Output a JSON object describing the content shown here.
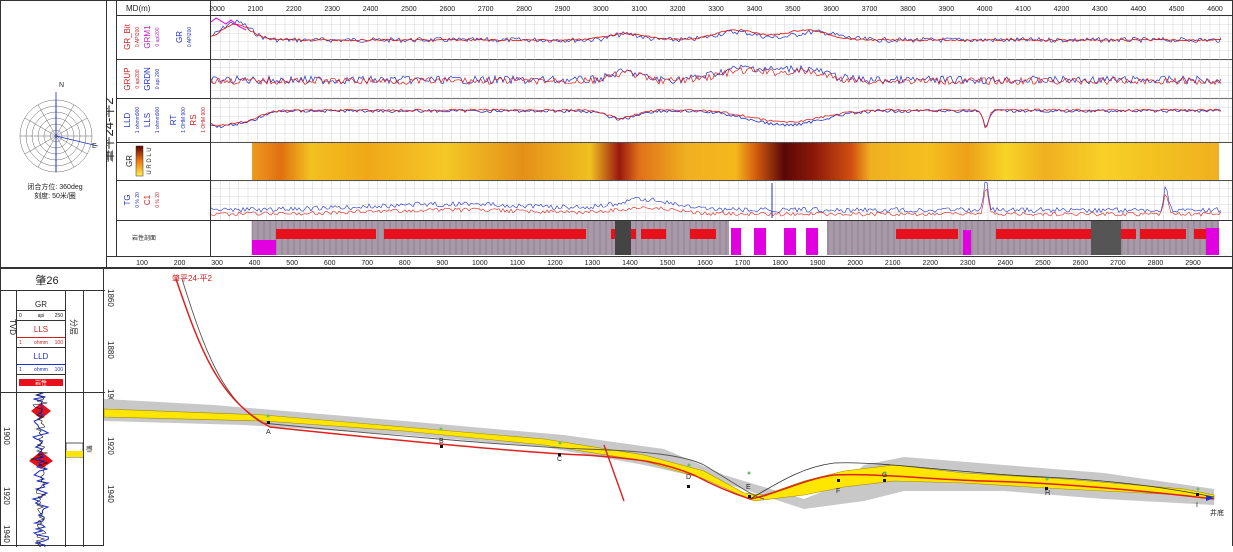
{
  "well_name": "肇平24-平2",
  "md_header": "MD(m)",
  "md_ticks": [
    "2000",
    "2100",
    "2200",
    "2300",
    "2400",
    "2500",
    "2600",
    "2700",
    "2800",
    "2900",
    "3000",
    "3100",
    "3200",
    "3300",
    "3400",
    "3500",
    "3600",
    "3700",
    "3800",
    "3900",
    "4000",
    "4100",
    "4200",
    "4300",
    "4400",
    "4500",
    "4600"
  ],
  "bottom_ticks": [
    "100",
    "200",
    "300",
    "400",
    "500",
    "600",
    "700",
    "800",
    "900",
    "1000",
    "1100",
    "1200",
    "1300",
    "1400",
    "1500",
    "1600",
    "1700",
    "1800",
    "1900",
    "2000",
    "2100",
    "2200",
    "2300",
    "2400",
    "2500",
    "2600",
    "2700",
    "2800",
    "2900"
  ],
  "compass": {
    "north": "N",
    "east": "E",
    "caption1": "闭合方位: 360deg",
    "caption2": "刻度: 50米/圈"
  },
  "tracks": {
    "t1": {
      "c1": "GR_Bit",
      "c1s": "0   API200",
      "c2": "GRM1",
      "c2s": "0   api200",
      "c3": "GR",
      "c3s": "0   API200"
    },
    "t2": {
      "c1": "GRUP",
      "c1s": "0   api200",
      "c2": "GRDN",
      "c2s": "0   api 200"
    },
    "t3": {
      "c1": "LLD",
      "c1s": "1 ohmm900",
      "c2": "LLS",
      "c2s": "1 ohmm900",
      "c3": "RT",
      "c3s": "1 OHM 900",
      "c4": "RS",
      "c4s": "1 OHM 900"
    },
    "t4": {
      "c1": "GR",
      "c1s": "30    160",
      "c2": "U R D L U"
    },
    "t5": {
      "c1": "TG",
      "c1s": "0  %  20",
      "c2": "C1",
      "c2s": "0  %  20"
    },
    "lith_label": "岩性剖面"
  },
  "ref_well": {
    "name": "肇26",
    "tvd": "TVD",
    "gr": "GR",
    "gr_scale_l": "0",
    "gr_scale_u": "api",
    "gr_scale_r": "250",
    "lls": "LLS",
    "lls_scale_l": "1",
    "lls_scale_u": "ohmm",
    "lls_scale_r": "100",
    "lld": "LLD",
    "lld_scale_l": "1",
    "lld_scale_u": "ohmm",
    "lld_scale_r": "100",
    "layer_label": "分层",
    "lith_tag": "岩性",
    "depths": [
      "1900",
      "1920",
      "1940"
    ],
    "zone_label": "葡I"
  },
  "section": {
    "well_label": "肇平24-平2",
    "depths": [
      "1860",
      "1880",
      "1900",
      "1920",
      "1940"
    ],
    "points": [
      "A",
      "B",
      "C",
      "D",
      "E",
      "F",
      "G",
      "H",
      "I"
    ],
    "end_label": "井底"
  },
  "colors": {
    "grid": "#b8b8b8",
    "red_curve": "#e0201c",
    "blue_curve": "#2030c8",
    "magenta": "#e000e0",
    "sand": "#ffe600",
    "shale": "#c8c8c8",
    "lith_red": "#e8101a",
    "lith_gray": "#a89aa8"
  }
}
